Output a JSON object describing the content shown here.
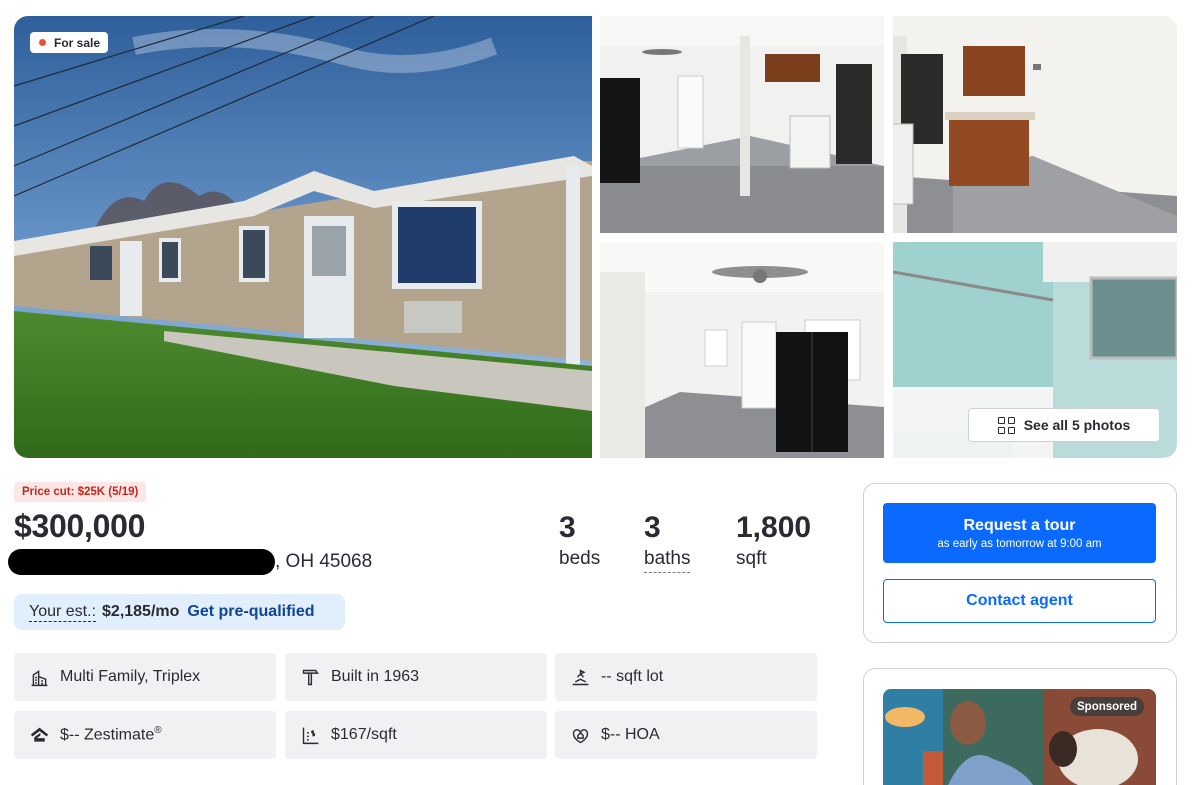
{
  "gallery": {
    "status_badge": "For sale",
    "see_all_label": "See all 5 photos",
    "photos": [
      {
        "subject": "building exterior"
      },
      {
        "subject": "living room with kitchen"
      },
      {
        "subject": "kitchen"
      },
      {
        "subject": "living room with fridge"
      },
      {
        "subject": "bathroom"
      }
    ]
  },
  "listing": {
    "price_cut": "Price cut: $25K (5/19)",
    "price": "$300,000",
    "address_visible": ", OH 45068",
    "beds": {
      "value": "3",
      "label": "beds"
    },
    "baths": {
      "value": "3",
      "label": "baths"
    },
    "sqft": {
      "value": "1,800",
      "label": "sqft"
    },
    "estimate": {
      "label": "Your est.:",
      "value": "$2,185/mo",
      "link": "Get pre-qualified"
    }
  },
  "facts": [
    {
      "icon": "building-icon",
      "text": "Multi Family, Triplex"
    },
    {
      "icon": "hammer-icon",
      "text": "Built in 1963"
    },
    {
      "icon": "lot-icon",
      "text": "-- sqft lot"
    },
    {
      "icon": "zestimate-icon",
      "text": "$-- Zestimate"
    },
    {
      "icon": "price-per-sqft-icon",
      "text": "$167/sqft"
    },
    {
      "icon": "hoa-icon",
      "text": "$-- HOA"
    }
  ],
  "zestimate_mark": "®",
  "actions": {
    "tour_title": "Request a tour",
    "tour_subtitle": "as early as tomorrow at 9:00 am",
    "contact": "Contact agent"
  },
  "ad": {
    "badge": "Sponsored"
  },
  "colors": {
    "primary": "#0a6aff",
    "link": "#0d4599",
    "price_cut_bg": "#fde6e6",
    "price_cut_text": "#c2281c",
    "status_dot": "#e5533d"
  }
}
